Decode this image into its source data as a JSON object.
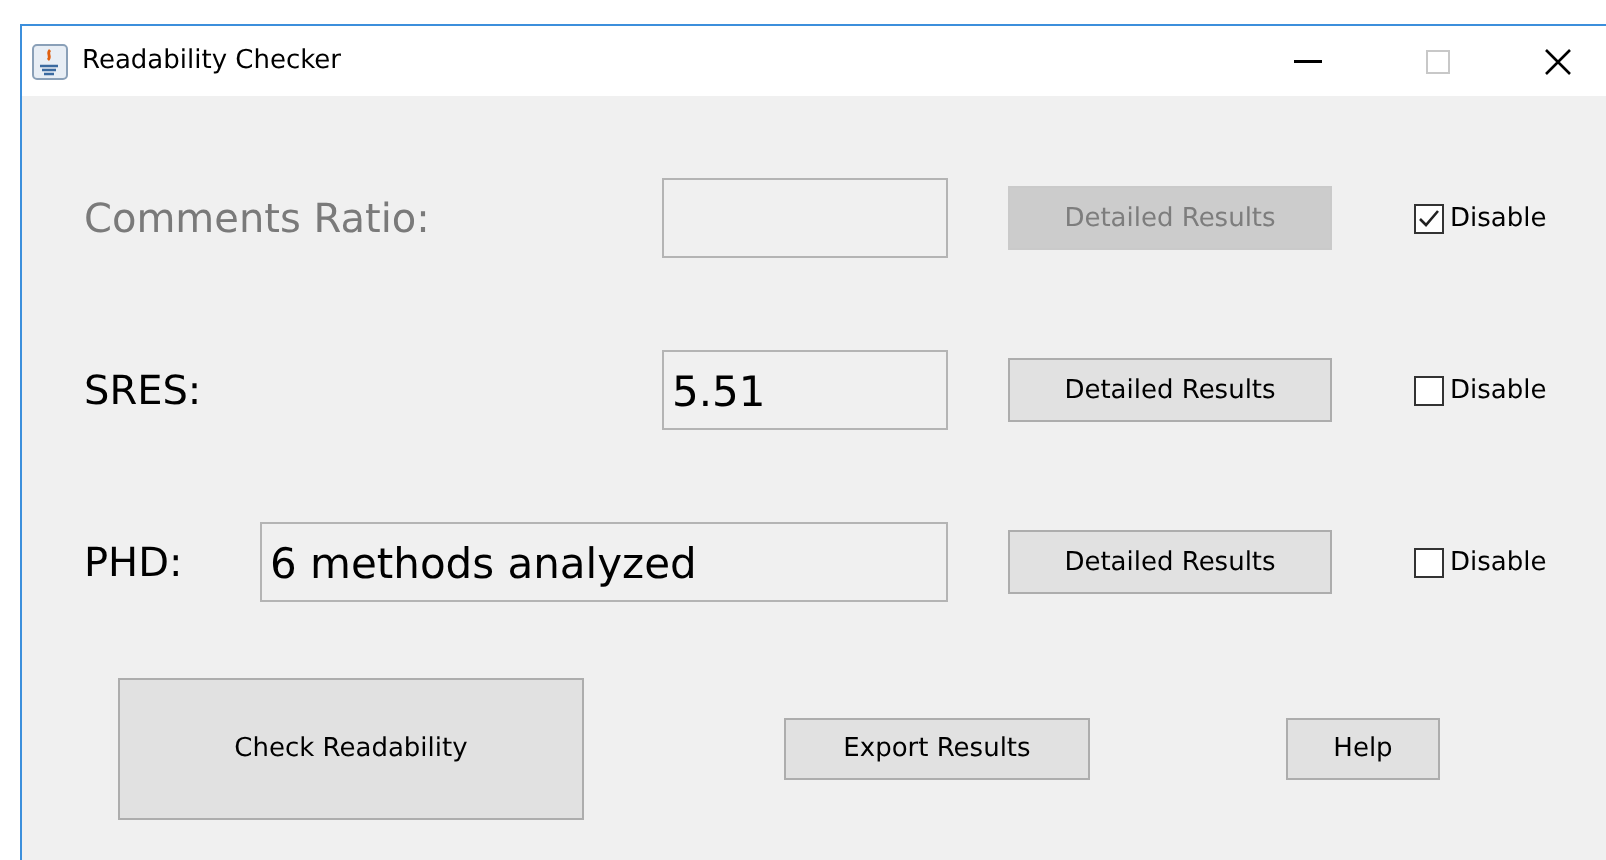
{
  "window": {
    "title": "Readability Checker"
  },
  "metrics": [
    {
      "kind": "narrow",
      "label": "Comments Ratio:",
      "button": "Detailed Results",
      "checkbox": {
        "label": "Disable",
        "checked": true
      }
    },
    {
      "kind": "narrow",
      "label": "SRES:",
      "value": "5.51",
      "button": "Detailed Results",
      "checkbox": {
        "label": "Disable",
        "checked": false
      }
    },
    {
      "kind": "wide",
      "label": "PHD:",
      "value": "6 methods analyzed",
      "button": "Detailed Results",
      "checkbox": {
        "label": "Disable",
        "checked": false
      }
    }
  ],
  "actions": {
    "check": "Check Readability",
    "export": "Export Results",
    "help": "Help"
  }
}
